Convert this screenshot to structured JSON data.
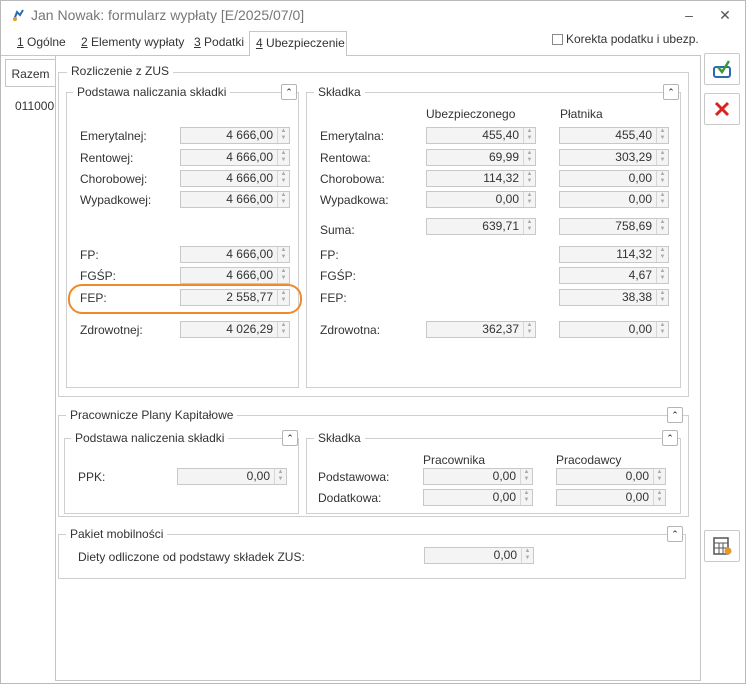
{
  "window": {
    "title": "Jan Nowak: formularz wypłaty [E/2025/07/0]",
    "minimize": "–",
    "close": "✕"
  },
  "tabs": [
    {
      "key": "1",
      "label": "Ogólne"
    },
    {
      "key": "2",
      "label": "Elementy wypłaty"
    },
    {
      "key": "3",
      "label": "Podatki"
    },
    {
      "key": "4",
      "label": "Ubezpieczenie"
    }
  ],
  "checkbox_korekta": {
    "label": "Korekta podatku i ubezp.",
    "checked": false
  },
  "sidebar": {
    "tab": "Razem",
    "item": "011000"
  },
  "zus": {
    "title": "Rozliczenie z ZUS",
    "podstawa": {
      "title": "Podstawa naliczania składki",
      "rows": [
        {
          "label": "Emerytalnej:",
          "value": "4 666,00"
        },
        {
          "label": "Rentowej:",
          "value": "4 666,00"
        },
        {
          "label": "Chorobowej:",
          "value": "4 666,00"
        },
        {
          "label": "Wypadkowej:",
          "value": "4 666,00"
        },
        {
          "label": "FP:",
          "value": "4 666,00"
        },
        {
          "label": "FGŚP:",
          "value": "4 666,00"
        },
        {
          "label": "FEP:",
          "value": "2 558,77"
        },
        {
          "label": "Zdrowotnej:",
          "value": "4 026,29"
        }
      ]
    },
    "skladka": {
      "title": "Składka",
      "col1": "Ubezpieczonego",
      "col2": "Płatnika",
      "rows": [
        {
          "label": "Emerytalna:",
          "ubezp": "455,40",
          "platnik": "455,40"
        },
        {
          "label": "Rentowa:",
          "ubezp": "69,99",
          "platnik": "303,29"
        },
        {
          "label": "Chorobowa:",
          "ubezp": "114,32",
          "platnik": "0,00"
        },
        {
          "label": "Wypadkowa:",
          "ubezp": "0,00",
          "platnik": "0,00"
        },
        {
          "label": "Suma:",
          "ubezp": "639,71",
          "platnik": "758,69"
        },
        {
          "label": "FP:",
          "platnik": "114,32"
        },
        {
          "label": "FGŚP:",
          "platnik": "4,67"
        },
        {
          "label": "FEP:",
          "platnik": "38,38"
        },
        {
          "label": "Zdrowotna:",
          "ubezp": "362,37",
          "platnik": "0,00"
        }
      ]
    }
  },
  "ppk": {
    "title": "Pracownicze Plany Kapitałowe",
    "podstawa": {
      "title": "Podstawa naliczenia składki",
      "label": "PPK:",
      "value": "0,00"
    },
    "skladka": {
      "title": "Składka",
      "col1": "Pracownika",
      "col2": "Pracodawcy",
      "rows": [
        {
          "label": "Podstawowa:",
          "pracownik": "0,00",
          "pracodawca": "0,00"
        },
        {
          "label": "Dodatkowa:",
          "pracownik": "0,00",
          "pracodawca": "0,00"
        }
      ]
    }
  },
  "pakiet": {
    "title": "Pakiet mobilności",
    "label": "Diety odliczone od podstawy składek ZUS:",
    "value": "0,00"
  },
  "icons": {
    "save": "save-icon",
    "cancel": "cancel-icon",
    "calc": "calculator-icon"
  },
  "colors": {
    "highlight": "#ee8a2c",
    "cancel_red": "#d9231f",
    "save_blue": "#2b6cb0"
  }
}
